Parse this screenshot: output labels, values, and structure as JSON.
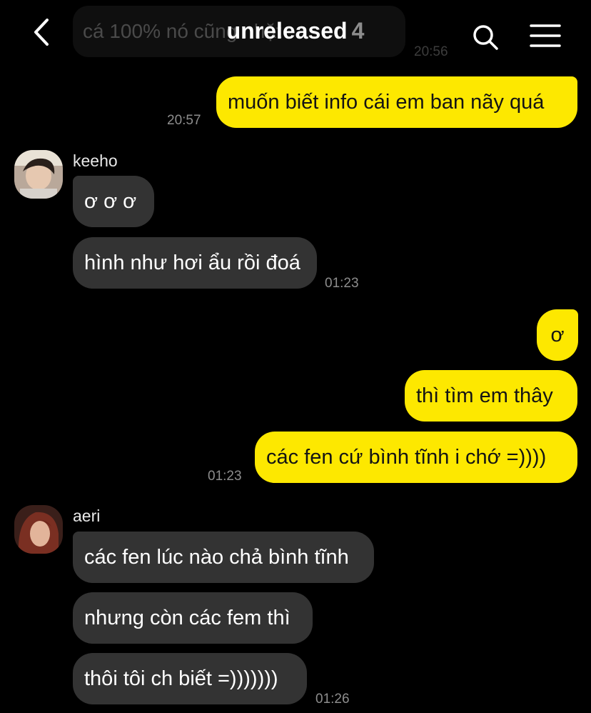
{
  "header": {
    "title": "unreleased",
    "member_count": "4",
    "back_icon": "chevron-left-icon",
    "search_icon": "search-icon",
    "menu_icon": "hamburger-menu-icon"
  },
  "previous_message": {
    "text": "cá 100% nó cũng nhặt",
    "time": "20:56"
  },
  "messages": [
    {
      "text": "muốn biết info cái em ban nãy quá",
      "time": "20:57"
    },
    {
      "sender": "keeho",
      "text": "ơ ơ ơ"
    },
    {
      "text": "hình như hơi ẩu rồi đoá",
      "time": "01:23"
    },
    {
      "text": "ơ"
    },
    {
      "text": "thì tìm em thây"
    },
    {
      "text": "các fen cứ bình tĩnh i chớ =))))",
      "time": "01:23"
    },
    {
      "sender": "aeri",
      "text": "các fen lúc nào chả bình tĩnh"
    },
    {
      "text": "nhưng còn các fem thì"
    },
    {
      "text": "thôi tôi ch biết =)))))))",
      "time": "01:26"
    }
  ],
  "colors": {
    "background": "#000000",
    "outgoing_bubble": "#fde800",
    "incoming_bubble": "#333333",
    "timestamp": "#8d8d8d"
  }
}
